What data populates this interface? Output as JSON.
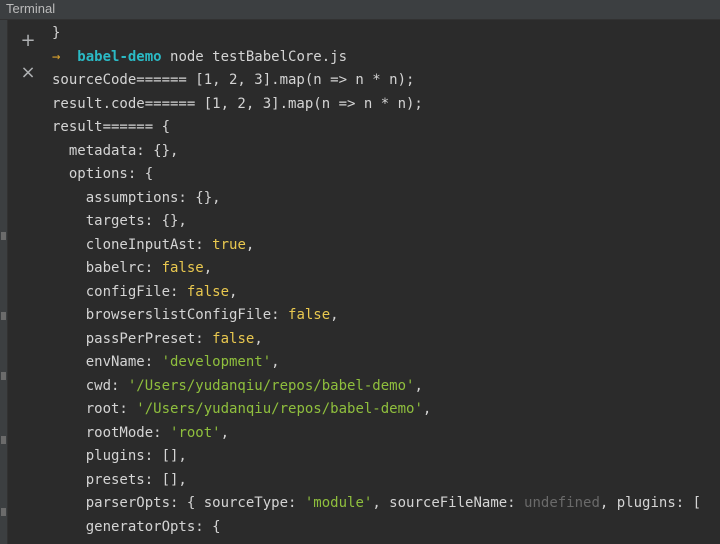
{
  "window": {
    "title": "Terminal"
  },
  "toolbar": {
    "add": "+",
    "close": "×"
  },
  "terminal": {
    "lines": [
      [
        {
          "t": "}",
          "c": "plain"
        }
      ],
      [
        {
          "t": "→  ",
          "c": "arrow"
        },
        {
          "t": "babel-demo",
          "c": "dir"
        },
        {
          "t": " node testBabelCore.js",
          "c": "plain"
        }
      ],
      [
        {
          "t": "sourceCode====== [1, 2, 3].map(n => n * n);",
          "c": "plain"
        }
      ],
      [
        {
          "t": "result.code====== [1, 2, 3].map(n => n * n);",
          "c": "plain"
        }
      ],
      [
        {
          "t": "result====== {",
          "c": "plain"
        }
      ],
      [
        {
          "t": "  metadata: {},",
          "c": "plain"
        }
      ],
      [
        {
          "t": "  options: {",
          "c": "plain"
        }
      ],
      [
        {
          "t": "    assumptions: {},",
          "c": "plain"
        }
      ],
      [
        {
          "t": "    targets: {},",
          "c": "plain"
        }
      ],
      [
        {
          "t": "    cloneInputAst: ",
          "c": "plain"
        },
        {
          "t": "true",
          "c": "bool"
        },
        {
          "t": ",",
          "c": "plain"
        }
      ],
      [
        {
          "t": "    babelrc: ",
          "c": "plain"
        },
        {
          "t": "false",
          "c": "bool"
        },
        {
          "t": ",",
          "c": "plain"
        }
      ],
      [
        {
          "t": "    configFile: ",
          "c": "plain"
        },
        {
          "t": "false",
          "c": "bool"
        },
        {
          "t": ",",
          "c": "plain"
        }
      ],
      [
        {
          "t": "    browserslistConfigFile: ",
          "c": "plain"
        },
        {
          "t": "false",
          "c": "bool"
        },
        {
          "t": ",",
          "c": "plain"
        }
      ],
      [
        {
          "t": "    passPerPreset: ",
          "c": "plain"
        },
        {
          "t": "false",
          "c": "bool"
        },
        {
          "t": ",",
          "c": "plain"
        }
      ],
      [
        {
          "t": "    envName: ",
          "c": "plain"
        },
        {
          "t": "'development'",
          "c": "str"
        },
        {
          "t": ",",
          "c": "plain"
        }
      ],
      [
        {
          "t": "    cwd: ",
          "c": "plain"
        },
        {
          "t": "'/Users/yudanqiu/repos/babel-demo'",
          "c": "str"
        },
        {
          "t": ",",
          "c": "plain"
        }
      ],
      [
        {
          "t": "    root: ",
          "c": "plain"
        },
        {
          "t": "'/Users/yudanqiu/repos/babel-demo'",
          "c": "str"
        },
        {
          "t": ",",
          "c": "plain"
        }
      ],
      [
        {
          "t": "    rootMode: ",
          "c": "plain"
        },
        {
          "t": "'root'",
          "c": "str"
        },
        {
          "t": ",",
          "c": "plain"
        }
      ],
      [
        {
          "t": "    plugins: [],",
          "c": "plain"
        }
      ],
      [
        {
          "t": "    presets: [],",
          "c": "plain"
        }
      ],
      [
        {
          "t": "    parserOpts: { sourceType: ",
          "c": "plain"
        },
        {
          "t": "'module'",
          "c": "str"
        },
        {
          "t": ", sourceFileName: ",
          "c": "plain"
        },
        {
          "t": "undefined",
          "c": "undef"
        },
        {
          "t": ", plugins: [",
          "c": "plain"
        }
      ],
      [
        {
          "t": "    generatorOpts: {",
          "c": "plain"
        }
      ]
    ]
  }
}
